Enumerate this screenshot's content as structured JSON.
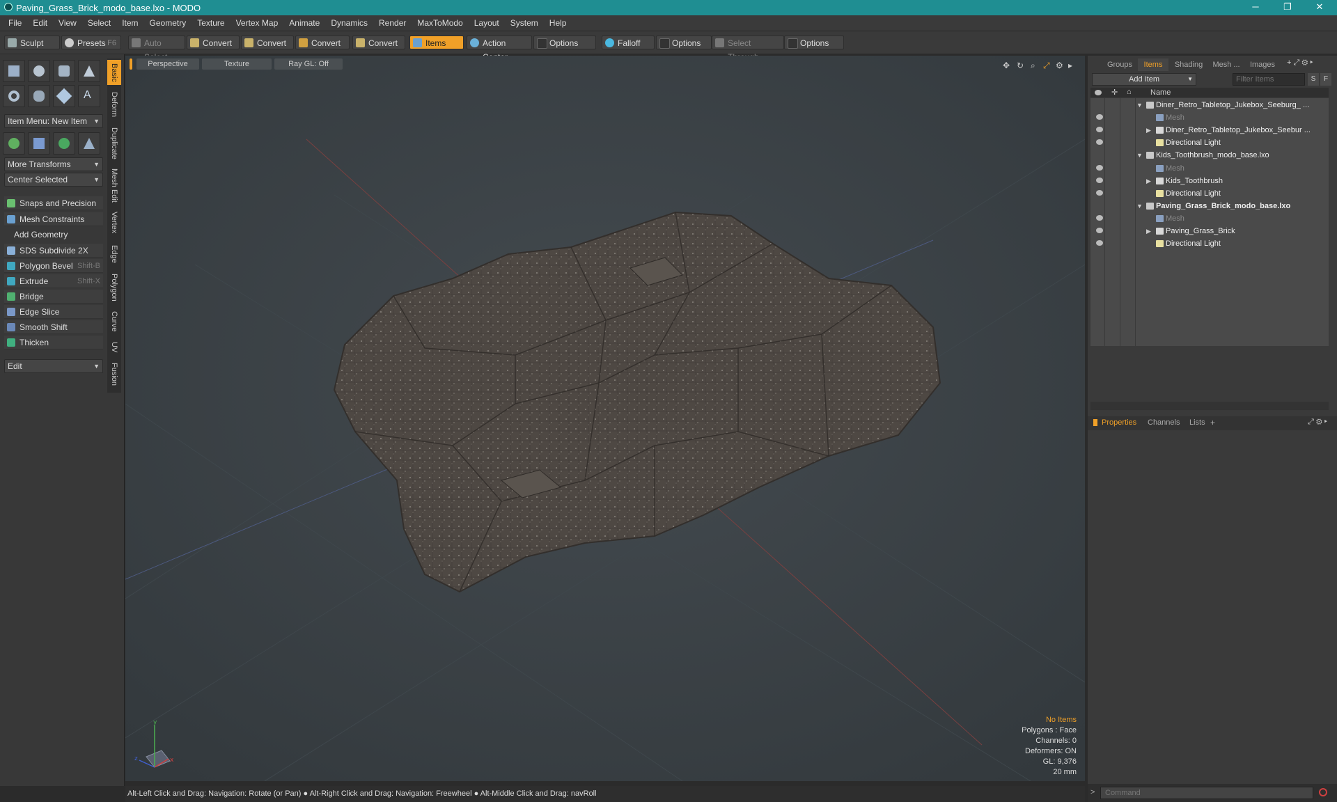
{
  "window": {
    "title": "Paving_Grass_Brick_modo_base.lxo - MODO",
    "controls": [
      "─",
      "❐",
      "✕"
    ]
  },
  "menu": [
    "File",
    "Edit",
    "View",
    "Select",
    "Item",
    "Geometry",
    "Texture",
    "Vertex Map",
    "Animate",
    "Dynamics",
    "Render",
    "MaxToModo",
    "Layout",
    "System",
    "Help"
  ],
  "toolbar": {
    "sculpt": "Sculpt",
    "presets": "Presets",
    "presets_hotkey": "F6",
    "auto_select": "Auto Select",
    "convert1": "Convert",
    "convert2": "Convert",
    "convert3": "Convert",
    "convert4": "Convert",
    "items": "Items",
    "action_center": "Action Center",
    "options1": "Options",
    "falloff": "Falloff",
    "options2": "Options",
    "select_through": "Select Through",
    "options3": "Options"
  },
  "left": {
    "item_menu": "Item Menu: New Item",
    "more_transforms": "More Transforms",
    "center_selected": "Center Selected",
    "snaps": "Snaps and Precision",
    "mesh_constraints": "Mesh Constraints",
    "add_geometry": "Add Geometry",
    "tools": [
      {
        "label": "SDS Subdivide 2X",
        "shortcut": ""
      },
      {
        "label": "Polygon Bevel",
        "shortcut": "Shift-B"
      },
      {
        "label": "Extrude",
        "shortcut": "Shift-X"
      },
      {
        "label": "Bridge",
        "shortcut": ""
      },
      {
        "label": "Edge Slice",
        "shortcut": ""
      },
      {
        "label": "Smooth Shift",
        "shortcut": ""
      },
      {
        "label": "Thicken",
        "shortcut": ""
      }
    ],
    "edit": "Edit",
    "vtabs": [
      "Basic",
      "Deform",
      "Duplicate",
      "Mesh Edit",
      "Vertex",
      "Edge",
      "Polygon",
      "Curve",
      "UV",
      "Fusion"
    ]
  },
  "viewport": {
    "view": "Perspective",
    "shading": "Texture",
    "raygl": "Ray GL: Off",
    "info": {
      "no_items": "No Items",
      "polygons": "Polygons : Face",
      "channels": "Channels: 0",
      "deformers": "Deformers: ON",
      "gl": "GL: 9,376",
      "size": "20 mm"
    }
  },
  "status": "Alt-Left Click and Drag: Navigation: Rotate (or Pan) ● Alt-Right Click and Drag: Navigation: Freewheel ● Alt-Middle Click and Drag: navRoll",
  "right": {
    "tabs": [
      "Groups",
      "Items",
      "Shading",
      "Mesh ...",
      "Images"
    ],
    "add_item": "Add Item",
    "filter_placeholder": "Filter Items",
    "filter_s": "S",
    "filter_f": "F",
    "col_name": "Name",
    "tree": [
      {
        "label": "Diner_Retro_Tabletop_Jukebox_Seeburg_ ...",
        "level": 0,
        "kind": "scene"
      },
      {
        "label": "Mesh",
        "level": 1,
        "kind": "mesh"
      },
      {
        "label": "Diner_Retro_Tabletop_Jukebox_Seebur ...",
        "level": 1,
        "kind": "group"
      },
      {
        "label": "Directional Light",
        "level": 1,
        "kind": "light"
      },
      {
        "label": "Kids_Toothbrush_modo_base.lxo",
        "level": 0,
        "kind": "scene"
      },
      {
        "label": "Mesh",
        "level": 1,
        "kind": "mesh"
      },
      {
        "label": "Kids_Toothbrush",
        "level": 1,
        "kind": "group"
      },
      {
        "label": "Directional Light",
        "level": 1,
        "kind": "light"
      },
      {
        "label": "Paving_Grass_Brick_modo_base.lxo",
        "level": 0,
        "kind": "scene"
      },
      {
        "label": "Mesh",
        "level": 1,
        "kind": "mesh"
      },
      {
        "label": "Paving_Grass_Brick",
        "level": 1,
        "kind": "group"
      },
      {
        "label": "Directional Light",
        "level": 1,
        "kind": "light"
      }
    ],
    "props_tabs": [
      "Properties",
      "Channels",
      "Lists"
    ],
    "command_placeholder": "Command"
  }
}
